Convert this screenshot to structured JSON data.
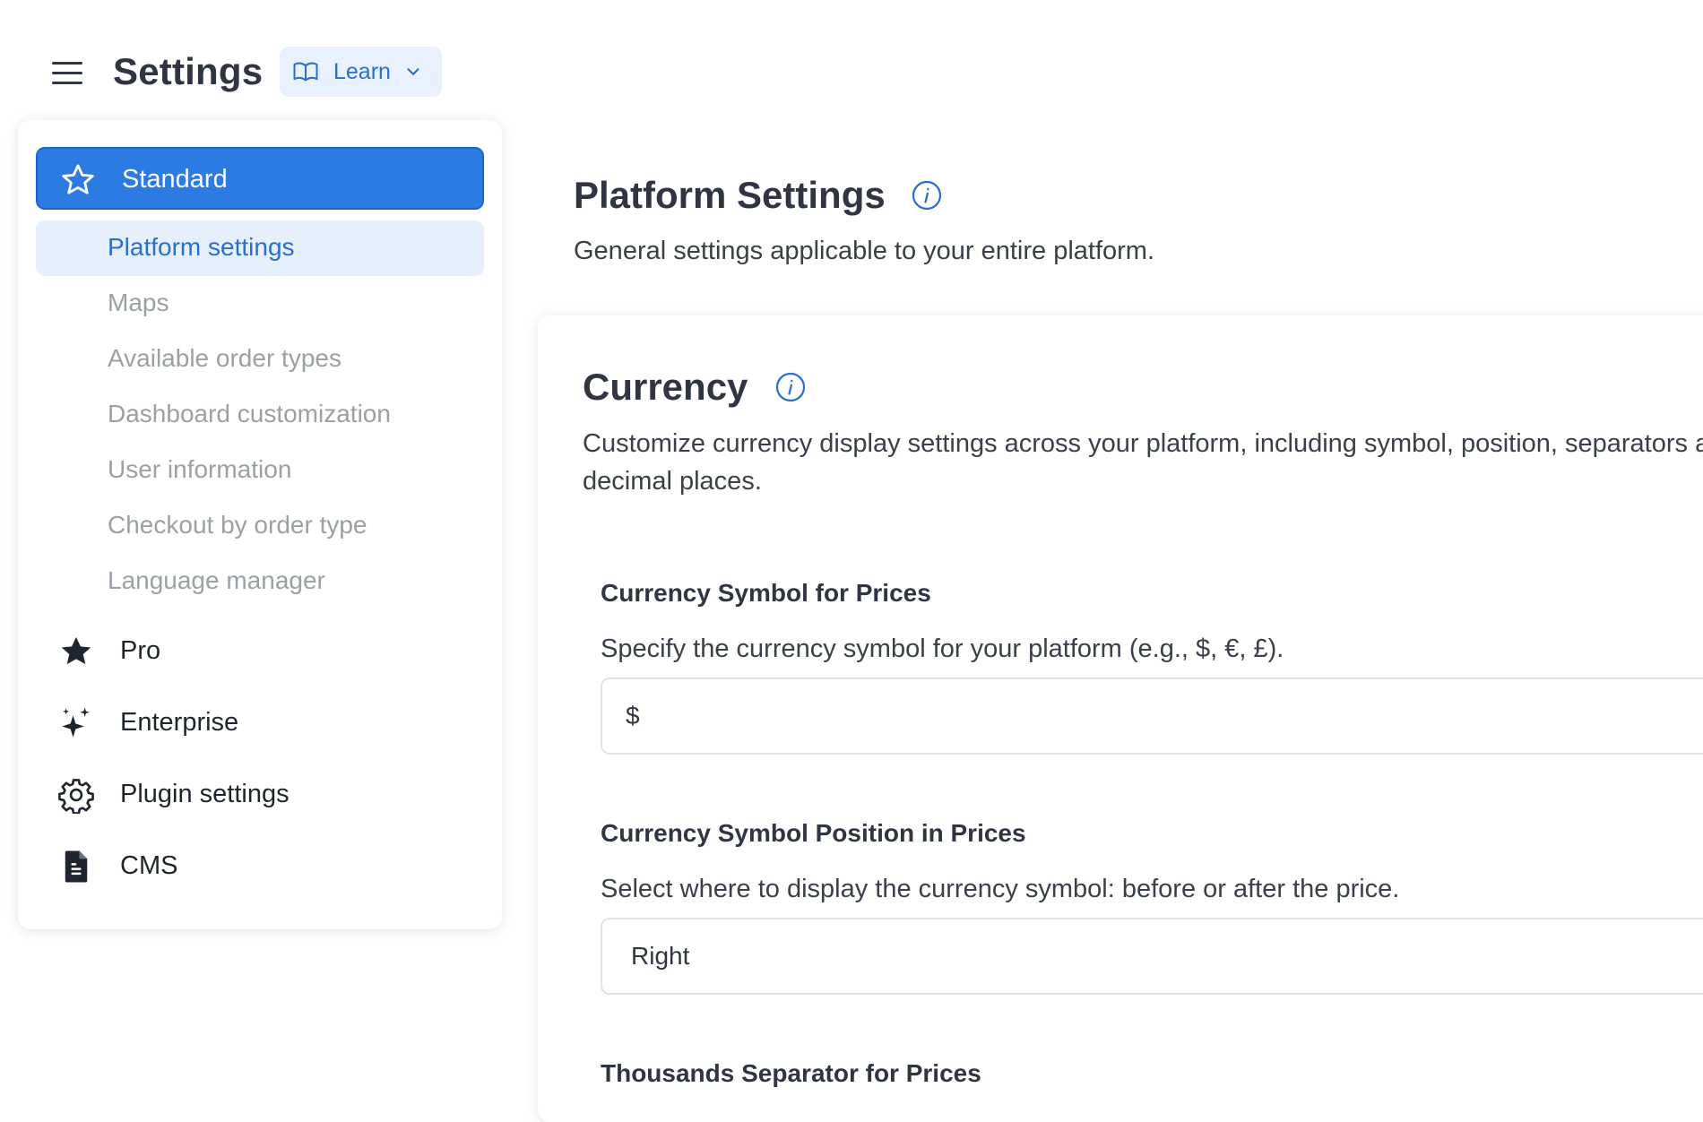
{
  "header": {
    "title": "Settings",
    "learn_label": "Learn"
  },
  "sidebar": {
    "active_section": "Standard",
    "sub_items": [
      {
        "label": "Platform settings",
        "selected": true
      },
      {
        "label": "Maps"
      },
      {
        "label": "Available order types"
      },
      {
        "label": "Dashboard customization"
      },
      {
        "label": "User information"
      },
      {
        "label": "Checkout by order type"
      },
      {
        "label": "Language manager"
      }
    ],
    "sections": [
      {
        "label": "Pro",
        "icon": "star-filled-icon"
      },
      {
        "label": "Enterprise",
        "icon": "sparkles-icon"
      },
      {
        "label": "Plugin settings",
        "icon": "gear-icon"
      },
      {
        "label": "CMS",
        "icon": "document-icon"
      }
    ]
  },
  "main": {
    "title": "Platform Settings",
    "subtitle": "General settings applicable to your entire platform.",
    "card": {
      "title": "Currency",
      "description": "Customize currency display settings across your platform, including symbol, position, separators and decimal places.",
      "fields": [
        {
          "label": "Currency Symbol for Prices",
          "help": "Specify the currency symbol for your platform (e.g., $, €, £).",
          "value": "$"
        },
        {
          "label": "Currency Symbol Position in Prices",
          "help": "Select where to display the currency symbol: before or after the price.",
          "value": "Right"
        },
        {
          "label": "Thousands Separator for Prices"
        }
      ]
    }
  },
  "colors": {
    "accent": "#2b7be3",
    "accent_light": "#e6f0fd",
    "text": "#2f3542",
    "muted": "#9aa0a8"
  }
}
